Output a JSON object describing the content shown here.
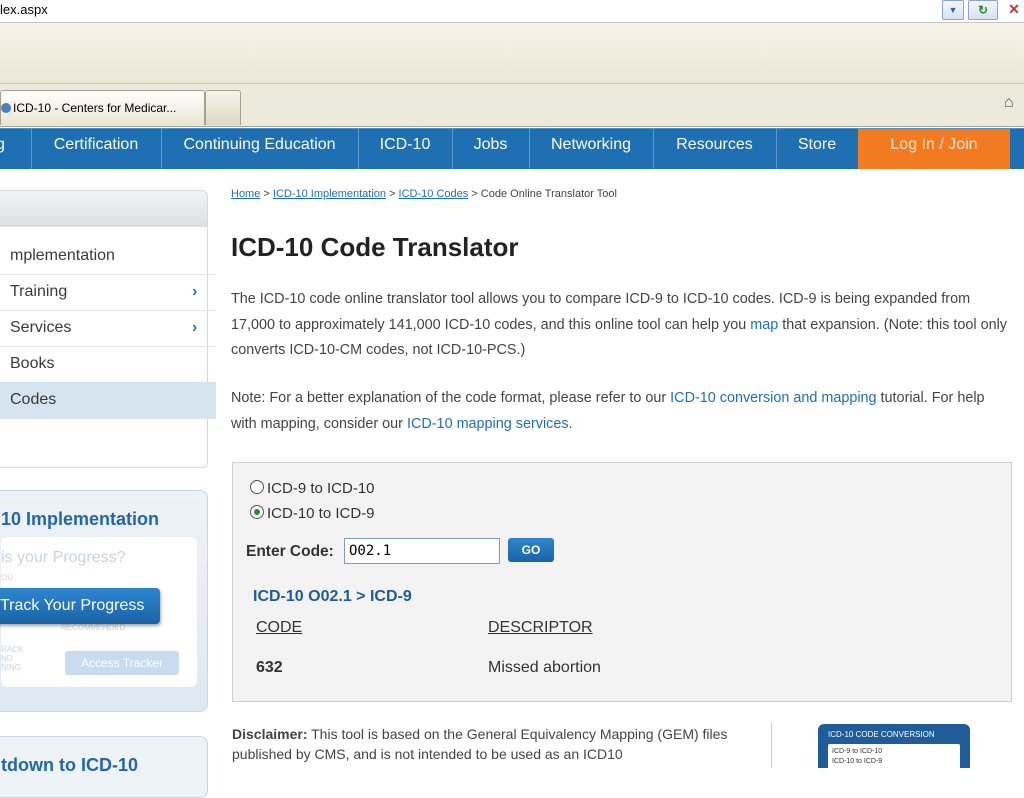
{
  "browser": {
    "url": "lex.aspx",
    "tabs": [
      {
        "label": "ICD-10 - Centers for Medicar..."
      }
    ],
    "refresh_glyph": "↻",
    "stop_glyph": "✕",
    "dropdown_glyph": "▼",
    "home_icon": "⌂"
  },
  "nav": {
    "items": [
      "g",
      "Certification",
      "Continuing Education",
      "ICD-10",
      "Jobs",
      "Networking",
      "Resources",
      "Store"
    ],
    "login": "Log In / Join",
    "accent": "#1f6fb3",
    "login_color": "#f27b21"
  },
  "sidebar": {
    "items": [
      {
        "label": "mplementation"
      },
      {
        "label": "Training",
        "arrow": "›"
      },
      {
        "label": "Services",
        "arrow": "›"
      },
      {
        "label": "Books"
      },
      {
        "label": "Codes"
      }
    ],
    "progress": {
      "title": "10 Implementation",
      "question": "is your Progress?",
      "faint_a": "OU",
      "faint_b": "RECOMMENDED",
      "faint_c": "RACK\nND\nNING",
      "track_button": "Track Your Progress",
      "access_button": "Access Tracker"
    },
    "countdown": {
      "title": "tdown to ICD-10"
    }
  },
  "breadcrumb": {
    "links": [
      "Home",
      "ICD-10 Implementation",
      "ICD-10 Codes"
    ],
    "separator": " > ",
    "current": "Code Online Translator Tool"
  },
  "page": {
    "title": "ICD-10 Code Translator",
    "intro_a": "The ICD-10 code online translator tool allows you to compare ICD-9 to ICD-10 codes. ICD-9 is being expanded from 17,000 to approximately 141,000 ICD-10 codes, and this online tool can help you ",
    "intro_link": "map",
    "intro_b": " that expansion. (Note: this tool only converts ICD-10-CM codes, not ICD-10-PCS.)",
    "note_a": "Note: For a better explanation of the code format, please refer to our ",
    "note_link1": "ICD-10 conversion and mapping",
    "note_b": " tutorial. For help with mapping, consider our ",
    "note_link2": "ICD-10 mapping services",
    "note_c": "."
  },
  "tool": {
    "radio_options": [
      {
        "label": "ICD-9 to ICD-10",
        "selected": false
      },
      {
        "label": "ICD-10 to ICD-9",
        "selected": true
      }
    ],
    "enter_label": "Enter Code:",
    "code_value": "O02.1",
    "go_label": "GO",
    "result_heading": "ICD-10 O02.1 > ICD-9",
    "columns": [
      "CODE",
      "DESCRIPTOR"
    ],
    "rows": [
      {
        "code": "632",
        "descriptor": "Missed abortion"
      }
    ]
  },
  "disclaimer": {
    "label": "Disclaimer:",
    "text": " This tool is based on the General Equivalency Mapping (GEM) files published by CMS, and is not intended to be used as an ICD10"
  },
  "promo": {
    "title": "ICD-10 CODE CONVERSION",
    "opt1": "ICD-9 to ICD-10",
    "opt2": "ICD-10 to ICD-9"
  }
}
